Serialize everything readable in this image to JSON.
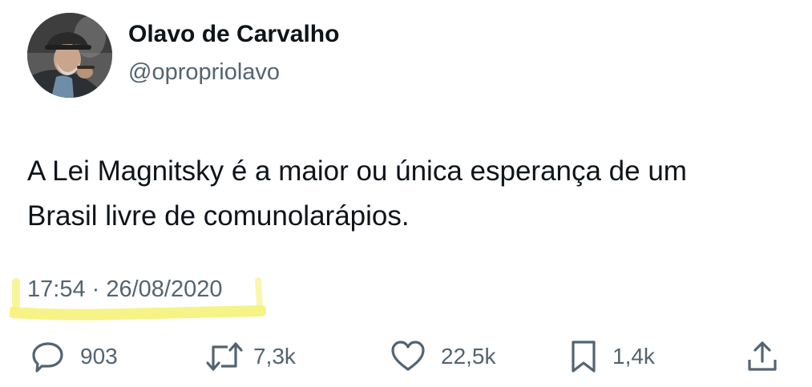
{
  "tweet": {
    "author": {
      "display_name": "Olavo de Carvalho",
      "handle": "@opropriolavo"
    },
    "text_lines": [
      "A Lei Magnitsky é a maior ou única esperança de um",
      "Brasil livre de comunolarápios."
    ],
    "timestamp": "17:54 · 26/08/2020",
    "highlight_color": "#f5f27a",
    "actions": {
      "replies": {
        "icon": "reply-bubble-icon",
        "count": "903"
      },
      "retweets": {
        "icon": "retweet-icon",
        "count": "7,3k"
      },
      "likes": {
        "icon": "heart-icon",
        "count": "22,5k"
      },
      "bookmarks": {
        "icon": "bookmark-icon",
        "count": "1,4k"
      },
      "share": {
        "icon": "share-icon"
      }
    }
  },
  "colors": {
    "text_primary": "#0f1419",
    "text_secondary": "#536471",
    "background": "#ffffff"
  }
}
